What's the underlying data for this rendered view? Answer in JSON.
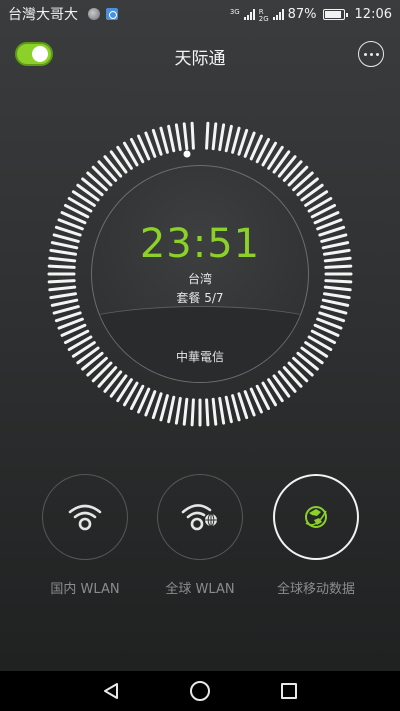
{
  "status_bar": {
    "carrier": "台灣大哥大",
    "net_3g": "3G",
    "net_2g": "2G",
    "net_r": "R",
    "battery_percent": "87%",
    "time": "12:06"
  },
  "header": {
    "title": "天际通",
    "toggle_on": true
  },
  "dial": {
    "time": "23:51",
    "region": "台湾",
    "plan": "套餐 5/7",
    "operator": "中華電信"
  },
  "modes": [
    {
      "label": "国内 WLAN",
      "icon": "wifi-icon",
      "active": false
    },
    {
      "label": "全球 WLAN",
      "icon": "global-wifi-icon",
      "active": false
    },
    {
      "label": "全球移动数据",
      "icon": "globe-data-icon",
      "active": true
    }
  ],
  "colors": {
    "accent": "#8bd12a",
    "background": "#2e3031",
    "navbar": "#000000"
  },
  "navbar": {
    "icons": [
      "back-icon",
      "home-icon",
      "recent-apps-icon"
    ]
  }
}
